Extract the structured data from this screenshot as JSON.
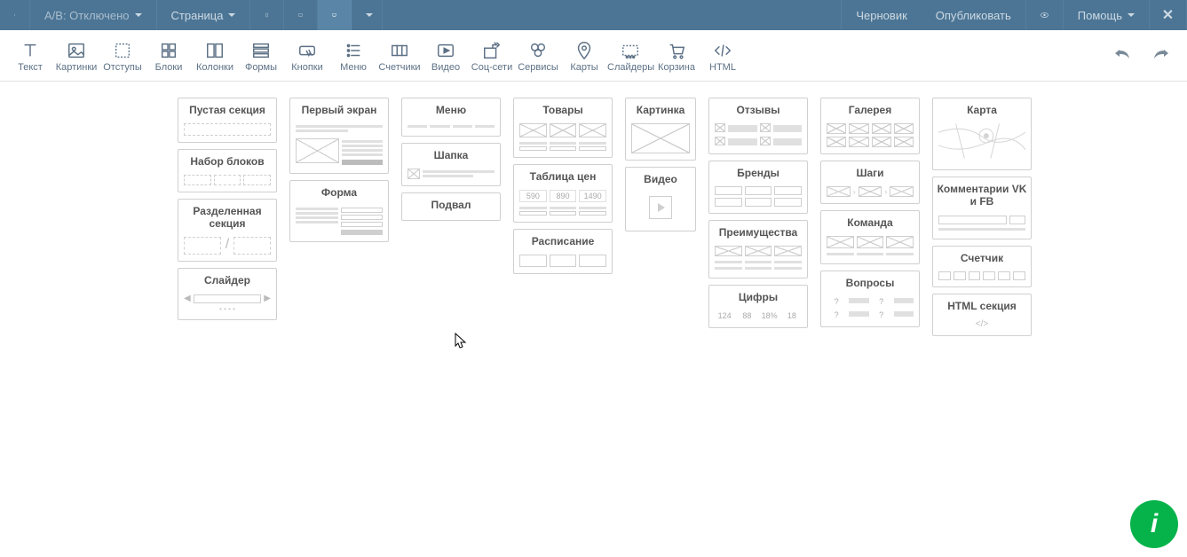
{
  "header": {
    "ab_label": "A/B: Отключено",
    "page_label": "Страница",
    "status": "Черновик",
    "publish": "Опубликовать",
    "help": "Помощь"
  },
  "tools": [
    {
      "id": "text",
      "label": "Текст"
    },
    {
      "id": "images",
      "label": "Картинки"
    },
    {
      "id": "padding",
      "label": "Отступы"
    },
    {
      "id": "blocks",
      "label": "Блоки"
    },
    {
      "id": "columns",
      "label": "Колонки"
    },
    {
      "id": "forms",
      "label": "Формы"
    },
    {
      "id": "buttons",
      "label": "Кнопки"
    },
    {
      "id": "menu",
      "label": "Меню"
    },
    {
      "id": "counters",
      "label": "Счетчики"
    },
    {
      "id": "video",
      "label": "Видео"
    },
    {
      "id": "social",
      "label": "Соц-сети"
    },
    {
      "id": "services",
      "label": "Сервисы"
    },
    {
      "id": "maps",
      "label": "Карты"
    },
    {
      "id": "sliders",
      "label": "Слайдеры"
    },
    {
      "id": "cart",
      "label": "Корзина"
    },
    {
      "id": "html",
      "label": "HTML"
    }
  ],
  "sections": {
    "col1": [
      "Пустая секция",
      "Набор блоков",
      "Разделенная секция",
      "Слайдер"
    ],
    "col2": [
      "Первый экран",
      "Форма"
    ],
    "col3": [
      "Меню",
      "Шапка",
      "Подвал"
    ],
    "col4": {
      "goods": "Товары",
      "pricing": "Таблица цен",
      "schedule": "Расписание",
      "prices": [
        "590",
        "890",
        "1490"
      ]
    },
    "col5": [
      "Картинка",
      "Видео"
    ],
    "col6": {
      "reviews": "Отзывы",
      "brands": "Бренды",
      "advantages": "Преимущества",
      "numbers": "Цифры",
      "numvals": [
        "124",
        "88",
        "18%",
        "18"
      ]
    },
    "col7": [
      "Галерея",
      "Шаги",
      "Команда",
      "Вопросы"
    ],
    "col8": [
      "Карта",
      "Комментарии VK и FB",
      "Счетчик",
      "HTML секция"
    ]
  },
  "qmark": "?"
}
